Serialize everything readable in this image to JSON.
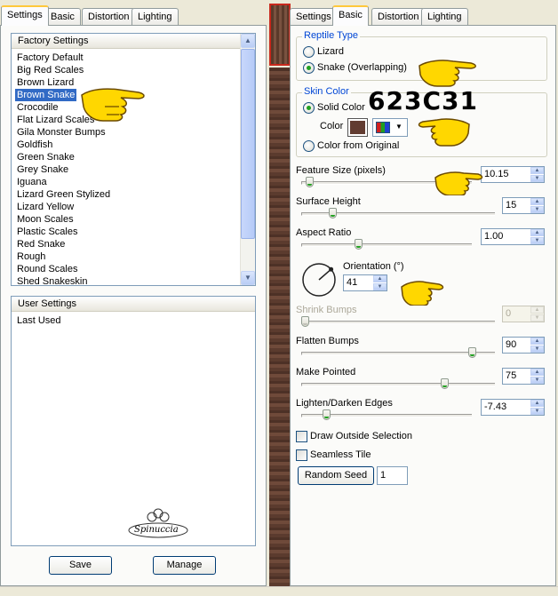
{
  "left_panel": {
    "tabs": [
      "Settings",
      "Basic",
      "Distortion",
      "Lighting"
    ],
    "factory_settings": {
      "header": "Factory Settings",
      "items": [
        "Factory Default",
        "Big Red Scales",
        "Brown Lizard",
        "Brown Snake",
        "Crocodile",
        "Flat Lizard Scales",
        "Gila Monster Bumps",
        "Goldfish",
        "Green Snake",
        "Grey Snake",
        "Iguana",
        "Lizard Green Stylized",
        "Lizard Yellow",
        "Moon Scales",
        "Plastic Scales",
        "Red Snake",
        "Rough",
        "Round Scales",
        "Shed Snakeskin"
      ],
      "selected": "Brown Snake"
    },
    "user_settings": {
      "header": "User Settings",
      "items": [
        "Last Used"
      ]
    },
    "watermark": "Spinuccia",
    "save_label": "Save",
    "manage_label": "Manage"
  },
  "right_panel": {
    "tabs": [
      "Settings",
      "Basic",
      "Distortion",
      "Lighting"
    ],
    "active_tab": "Basic",
    "reptile_type": {
      "legend": "Reptile Type",
      "options": [
        "Lizard",
        "Snake (Overlapping)"
      ],
      "selected": "Snake (Overlapping)"
    },
    "skin_color": {
      "legend": "Skin Color",
      "solid_color_label": "Solid Color",
      "color_label": "Color",
      "swatch_color": "#623C31",
      "from_original_label": "Color from Original",
      "selected": "Solid Color"
    },
    "annotation_hex": "623C31",
    "feature_size": {
      "label": "Feature Size (pixels)",
      "value": "10.15",
      "level": 0.03
    },
    "surface_height": {
      "label": "Surface Height",
      "value": "15",
      "level": 0.15
    },
    "aspect_ratio": {
      "label": "Aspect Ratio",
      "value": "1.00",
      "level": 0.33
    },
    "orientation": {
      "label": "Orientation (°)",
      "value": "41",
      "angle": 41
    },
    "shrink_bumps": {
      "label": "Shrink Bumps",
      "value": "0",
      "level": 0.0,
      "disabled": true
    },
    "flatten_bumps": {
      "label": "Flatten Bumps",
      "value": "90",
      "level": 0.9
    },
    "make_pointed": {
      "label": "Make Pointed",
      "value": "75",
      "level": 0.75
    },
    "lighten_darken": {
      "label": "Lighten/Darken Edges",
      "value": "-7.43",
      "level": 0.13
    },
    "draw_outside_label": "Draw Outside Selection",
    "seamless_tile_label": "Seamless Tile",
    "random_seed_label": "Random Seed",
    "random_seed_value": "1"
  },
  "colors": {
    "accent": "#316ac5",
    "tab_highlight": "#ffc83c",
    "legend_blue": "#0046d5",
    "preview_frame": "#c8281c",
    "hand_yellow": "#ffd700"
  }
}
